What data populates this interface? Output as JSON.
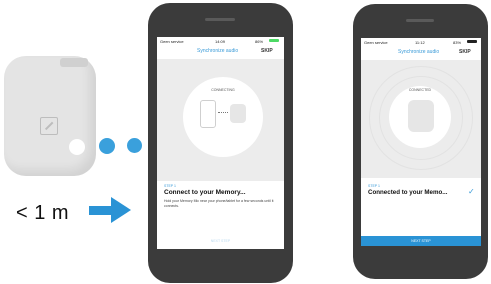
{
  "illustration": {
    "range_label": "< 1 m"
  },
  "phone1": {
    "status": {
      "carrier": "Geen service",
      "time": "14:09",
      "battery": "86%"
    },
    "nav": {
      "title": "Synchronize audio",
      "skip": "SKIP"
    },
    "connection_label": "CONNECTING",
    "step": "STEP 1",
    "heading": "Connect to your Memory...",
    "description": "Hold your Memory Mic near your phone/tablet for a few seconds until it connects.",
    "button": "NEXT STEP"
  },
  "phone2": {
    "status": {
      "carrier": "Geen service",
      "time": "11:12",
      "battery": "83%"
    },
    "nav": {
      "title": "Synchronize audio",
      "skip": "SKIP"
    },
    "connection_label": "CONNECTED",
    "step": "STEP 1",
    "heading": "Connected to your Memo...",
    "checkmark": "✓",
    "button": "NEXT STEP"
  },
  "colors": {
    "accent": "#3a9bd8",
    "phone_body": "#3b3b3b"
  }
}
